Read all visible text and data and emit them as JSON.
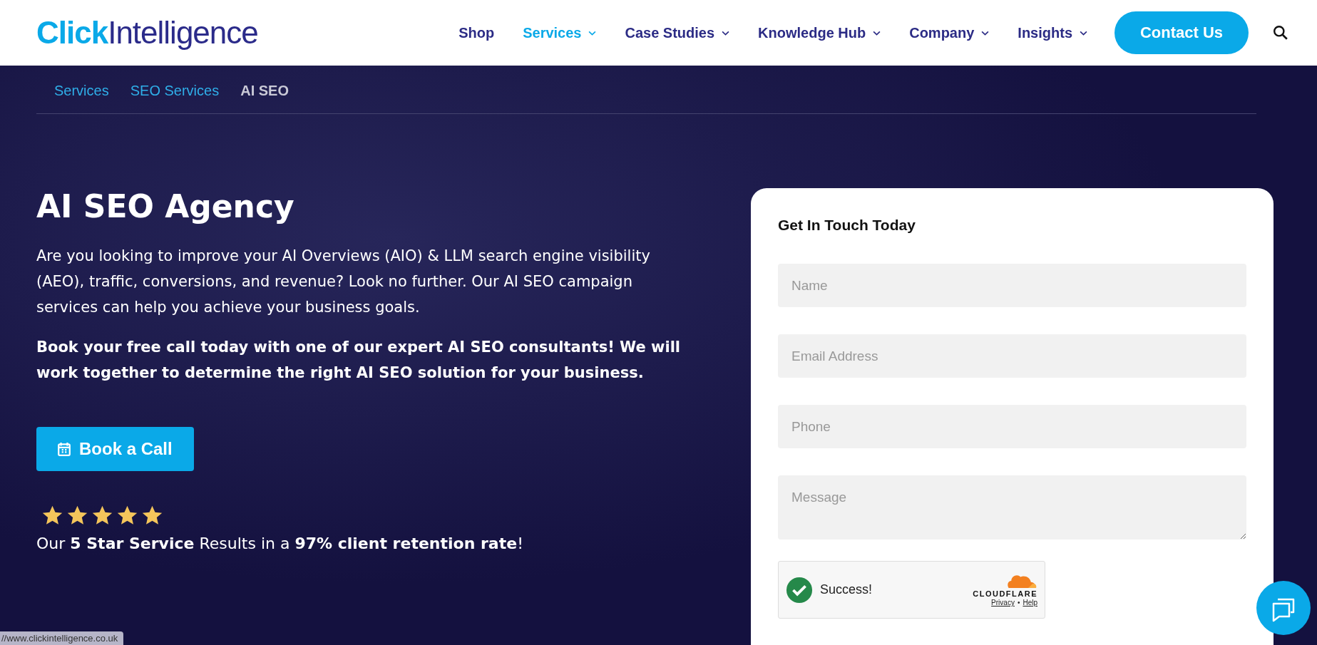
{
  "header": {
    "logo": {
      "bold": "Click",
      "light": "Intelligence"
    },
    "nav": [
      {
        "label": "Shop",
        "dropdown": false,
        "selected": false
      },
      {
        "label": "Services",
        "dropdown": true,
        "selected": true
      },
      {
        "label": "Case Studies",
        "dropdown": true,
        "selected": false
      },
      {
        "label": "Knowledge Hub",
        "dropdown": true,
        "selected": false
      },
      {
        "label": "Company",
        "dropdown": true,
        "selected": false
      },
      {
        "label": "Insights",
        "dropdown": true,
        "selected": false
      }
    ],
    "contact_button": "Contact Us"
  },
  "breadcrumbs": [
    {
      "label": "Services",
      "current": false
    },
    {
      "label": "SEO Services",
      "current": false
    },
    {
      "label": "AI SEO",
      "current": true
    }
  ],
  "hero": {
    "title": "AI SEO Agency",
    "intro": "Are you looking to improve your AI Overviews (AIO) & LLM search engine visibility (AEO), traffic, conversions, and revenue? Look no further. Our AI SEO campaign services can help you achieve your business goals.",
    "cta_text": "Book your free call today with one of our expert AI SEO consultants! We will work together to determine the right AI SEO solution for your business.",
    "button": "Book a Call",
    "rating": {
      "stars": 5,
      "text": "Our **5 Star Service** Results in a **97% client retention rate**!"
    }
  },
  "form": {
    "title": "Get In Touch Today",
    "fields": [
      {
        "kind": "input",
        "placeholder": "Name"
      },
      {
        "kind": "input",
        "placeholder": "Email Address"
      },
      {
        "kind": "input",
        "placeholder": "Phone"
      },
      {
        "kind": "textarea",
        "placeholder": "Message"
      }
    ],
    "captcha": {
      "status": "Success!",
      "brand": "CLOUDFLARE",
      "links": [
        "Privacy",
        "Help"
      ],
      "separator": "•"
    }
  },
  "status_url": "//www.clickintelligence.co.uk"
}
